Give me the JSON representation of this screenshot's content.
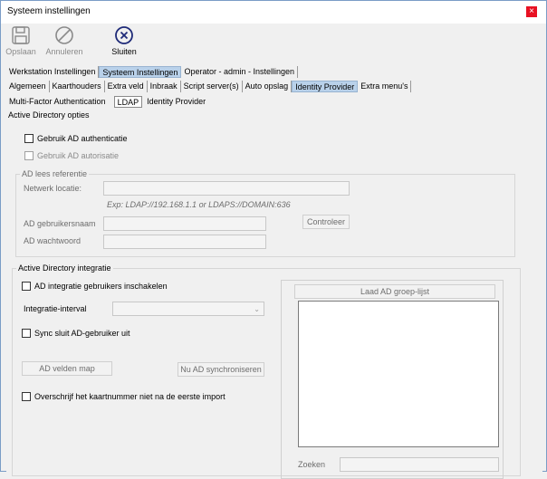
{
  "window": {
    "title": "Systeem instellingen",
    "close_glyph": "×"
  },
  "toolbar": {
    "save": {
      "label": "Opslaan",
      "icon": "floppy-disk-icon"
    },
    "cancel": {
      "label": "Annuleren",
      "icon": "prohibit-icon"
    },
    "close": {
      "label": "Sluiten",
      "icon": "circle-x-icon"
    }
  },
  "tabs_level1": [
    "Werkstation Instellingen",
    "Systeem Instellingen",
    "Operator - admin - Instellingen"
  ],
  "tabs_level2": [
    "Algemeen",
    "Kaarthouders",
    "Extra veld",
    "Inbraak",
    "Script server(s)",
    "Auto opslag",
    "Identity Provider",
    "Extra menu's"
  ],
  "tabs_level3": [
    "Multi-Factor Authentication",
    "LDAP",
    "Identity Provider"
  ],
  "ad_opties": {
    "title": "Active Directory opties",
    "use_auth": "Gebruik AD authenticatie",
    "use_authz": "Gebruik AD autorisatie"
  },
  "ad_ref": {
    "legend": "AD lees referentie",
    "network_label": "Netwerk locatie:",
    "network_hint": "Exp: LDAP://192.168.1.1 or LDAPS://DOMAIN:636",
    "user_label": "AD gebruikersnaam",
    "password_label": "AD wachtwoord",
    "check_button": "Controleer"
  },
  "ad_integratie": {
    "legend": "Active Directory integratie",
    "enable_users": "AD integratie gebruikers inschakelen",
    "interval_label": "Integratie-interval",
    "sync_close": "Sync sluit AD-gebruiker uit",
    "map_button": "AD velden map",
    "sync_button": "Nu AD synchroniseren",
    "overwrite": "Overschrijf het kaartnummer niet na de eerste import",
    "load_groups_button": "Laad AD groep-lijst",
    "search_label": "Zoeken"
  }
}
